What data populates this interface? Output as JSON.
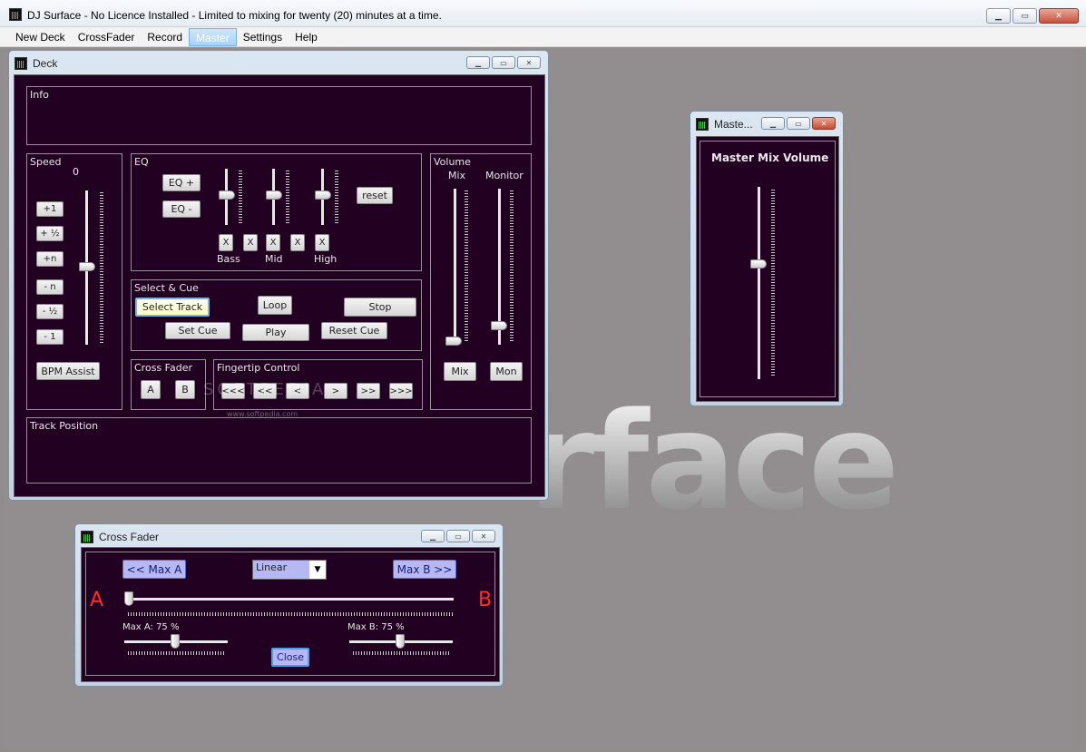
{
  "app": {
    "title": "DJ Surface - No Licence Installed - Limited to mixing for twenty (20) minutes at a time."
  },
  "menu": [
    "New Deck",
    "CrossFader",
    "Record",
    "Master",
    "Settings",
    "Help"
  ],
  "menu_active": "Master",
  "background_logo": "rface",
  "deck": {
    "title": "Deck",
    "info_label": "Info",
    "speed_label": "Speed",
    "speed_value": "0",
    "speed_buttons": [
      "+1",
      "+ ½",
      "+n",
      "- n",
      "- ½",
      "- 1"
    ],
    "bpm_assist": "BPM Assist",
    "eq_label": "EQ",
    "eq_plus": "EQ +",
    "eq_minus": "EQ -",
    "eq_reset": "reset",
    "eq_x": [
      "X",
      "X",
      "X",
      "X",
      "X"
    ],
    "eq_bands": [
      "Bass",
      "Mid",
      "High"
    ],
    "select_cue_label": "Select & Cue",
    "select_track": "Select Track",
    "loop": "Loop",
    "stop": "Stop",
    "set_cue": "Set Cue",
    "play": "Play",
    "reset_cue": "Reset Cue",
    "cross_fader_label": "Cross Fader",
    "cf_a": "A",
    "cf_b": "B",
    "fingertip_label": "Fingertip Control",
    "fingertip_buttons": [
      "<<<",
      "<<",
      "<",
      ">",
      ">>",
      ">>>"
    ],
    "volume_label": "Volume",
    "mix_label": "Mix",
    "monitor_label": "Monitor",
    "mix_button": "Mix",
    "mon_button": "Mon",
    "track_position_label": "Track Position",
    "watermark": "SOFTPEDIA",
    "watermark_url": "www.softpedia.com"
  },
  "master": {
    "title": "Maste...",
    "heading": "Master Mix Volume"
  },
  "crossfader": {
    "title": "Cross Fader",
    "max_a": "<< Max A",
    "max_b": "Max B >>",
    "mode": "Linear",
    "letter_a": "A",
    "letter_b": "B",
    "max_a_label": "Max A: 75 %",
    "max_b_label": "Max B: 75 %",
    "close": "Close",
    "max_a_value": 0.75,
    "max_b_value": 0.75
  },
  "colors": {
    "panel_bg": "#220022",
    "accent_blue": "#b5b8f3",
    "red": "#ff2a2a"
  }
}
